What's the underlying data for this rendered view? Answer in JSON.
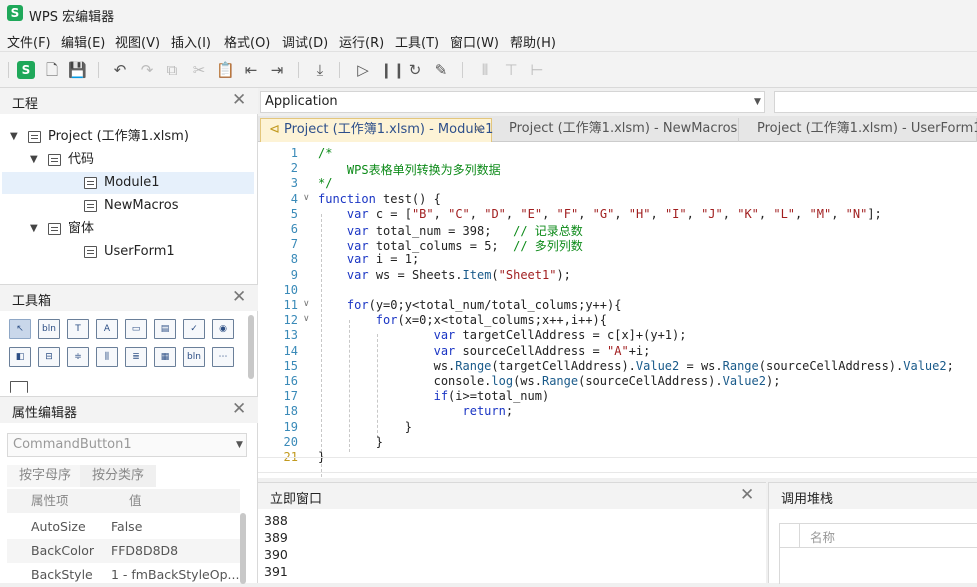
{
  "app": {
    "title": "WPS 宏编辑器",
    "logo": "S"
  },
  "menu": [
    "文件(F)",
    "编辑(E)",
    "视图(V)",
    "插入(I)",
    "格式(O)",
    "调试(D)",
    "运行(R)",
    "工具(T)",
    "窗口(W)",
    "帮助(H)"
  ],
  "toolbar_icons": [
    "wps-logo-icon",
    "new-file-icon",
    "save-icon",
    "undo-icon",
    "redo-icon",
    "copy-icon",
    "cut-icon",
    "paste-icon",
    "outdent-icon",
    "indent-icon",
    "import-icon",
    "run-icon",
    "pause-icon",
    "reset-icon",
    "design-mode-icon",
    "align-icon",
    "align2-icon",
    "align3-icon"
  ],
  "project_panel": {
    "title": "工程",
    "close": "✕",
    "tree": [
      {
        "label": "Project (工作簿1.xlsm)",
        "level": 0,
        "caret": "▼",
        "icon": "project-icon"
      },
      {
        "label": "代码",
        "level": 1,
        "caret": "▼",
        "icon": "code-folder-icon"
      },
      {
        "label": "Module1",
        "level": 2,
        "caret": "",
        "icon": "module-icon",
        "selected": true
      },
      {
        "label": "NewMacros",
        "level": 2,
        "caret": "",
        "icon": "module-icon"
      },
      {
        "label": "窗体",
        "level": 1,
        "caret": "▼",
        "icon": "form-folder-icon"
      },
      {
        "label": "UserForm1",
        "level": 2,
        "caret": "",
        "icon": "form-icon"
      }
    ]
  },
  "toolbox_panel": {
    "title": "工具箱",
    "close": "✕",
    "tools": [
      {
        "glyph": "↖",
        "name": "pointer-tool",
        "selected": true
      },
      {
        "glyph": "bln",
        "name": "label-tool"
      },
      {
        "glyph": "T",
        "name": "textbox-tool"
      },
      {
        "glyph": "A",
        "name": "frame-tool"
      },
      {
        "glyph": "▭",
        "name": "combobox-tool"
      },
      {
        "glyph": "▤",
        "name": "listbox-tool"
      },
      {
        "glyph": "✓",
        "name": "checkbox-tool"
      },
      {
        "glyph": "◉",
        "name": "optionbutton-tool"
      },
      {
        "glyph": "◧",
        "name": "togglebutton-tool"
      },
      {
        "glyph": "⊟",
        "name": "spin-tool"
      },
      {
        "glyph": "≑",
        "name": "scrollbar-tool"
      },
      {
        "glyph": "⫼",
        "name": "tabstrip-tool"
      },
      {
        "glyph": "≣",
        "name": "multipage-tool"
      },
      {
        "glyph": "▦",
        "name": "image-tool"
      },
      {
        "glyph": "bln",
        "name": "commandbutton-tool"
      },
      {
        "glyph": "⋯",
        "name": "refedit-tool"
      }
    ]
  },
  "properties_panel": {
    "title": "属性编辑器",
    "close": "✕",
    "object": "CommandButton1",
    "tabs": [
      "按字母序",
      "按分类序"
    ],
    "header": {
      "key": "属性项",
      "value": "值"
    },
    "rows": [
      {
        "key": "AutoSize",
        "value": "False"
      },
      {
        "key": "BackColor",
        "value": "FFD8D8D8"
      },
      {
        "key": "BackStyle",
        "value": "1 - fmBackStyleOp..."
      }
    ]
  },
  "editor_header": {
    "object": "Application",
    "procedure": ""
  },
  "tabs": [
    {
      "label": "Project (工作簿1.xlsm) - Module1",
      "active": true,
      "close": "✕"
    },
    {
      "label": "Project (工作簿1.xlsm) - NewMacros",
      "active": false
    },
    {
      "label": "Project (工作簿1.xlsm) - UserForm1",
      "active": false
    }
  ],
  "code_lines": [
    {
      "n": "1",
      "t": "/*",
      "fold": ""
    },
    {
      "n": "2",
      "t": "    WPS表格单列转换为多列数据",
      "fold": ""
    },
    {
      "n": "3",
      "t": "*/",
      "fold": ""
    },
    {
      "n": "4",
      "t": "function test() {",
      "fold": "∨"
    },
    {
      "n": "5",
      "t": "    var c = [\"B\", \"C\", \"D\", \"E\", \"F\", \"G\", \"H\", \"I\", \"J\", \"K\", \"L\", \"M\", \"N\"];",
      "fold": ""
    },
    {
      "n": "6",
      "t": "    var total_num = 398;   // 记录总数",
      "fold": ""
    },
    {
      "n": "7",
      "t": "    var total_colums = 5;  // 多列列数",
      "fold": ""
    },
    {
      "n": "8",
      "t": "    var i = 1;",
      "fold": ""
    },
    {
      "n": "9",
      "t": "    var ws = Sheets.Item(\"Sheet1\");",
      "fold": ""
    },
    {
      "n": "10",
      "t": "",
      "fold": ""
    },
    {
      "n": "11",
      "t": "    for(y=0;y<total_num/total_colums;y++){",
      "fold": "∨"
    },
    {
      "n": "12",
      "t": "        for(x=0;x<total_colums;x++,i++){",
      "fold": "∨"
    },
    {
      "n": "13",
      "t": "                var targetCellAddress = c[x]+(y+1);",
      "fold": ""
    },
    {
      "n": "14",
      "t": "                var sourceCellAddress = \"A\"+i;",
      "fold": ""
    },
    {
      "n": "15",
      "t": "                ws.Range(targetCellAddress).Value2 = ws.Range(sourceCellAddress).Value2;",
      "fold": ""
    },
    {
      "n": "16",
      "t": "                console.log(ws.Range(sourceCellAddress).Value2);",
      "fold": ""
    },
    {
      "n": "17",
      "t": "                if(i>=total_num)",
      "fold": ""
    },
    {
      "n": "18",
      "t": "                    return;",
      "fold": ""
    },
    {
      "n": "19",
      "t": "            }",
      "fold": ""
    },
    {
      "n": "20",
      "t": "        }",
      "fold": ""
    },
    {
      "n": "21",
      "t": "}",
      "fold": ""
    }
  ],
  "immediate": {
    "title": "立即窗口",
    "close": "✕",
    "lines": [
      "388",
      "389",
      "390",
      "391"
    ]
  },
  "callstack": {
    "title": "调用堆栈",
    "column": "名称"
  },
  "colors": {
    "accent": "#1fa85a",
    "keyword": "#1a35c4",
    "comment": "#0c8a18",
    "string": "#a11f20",
    "line_number": "#3a8ab8"
  }
}
